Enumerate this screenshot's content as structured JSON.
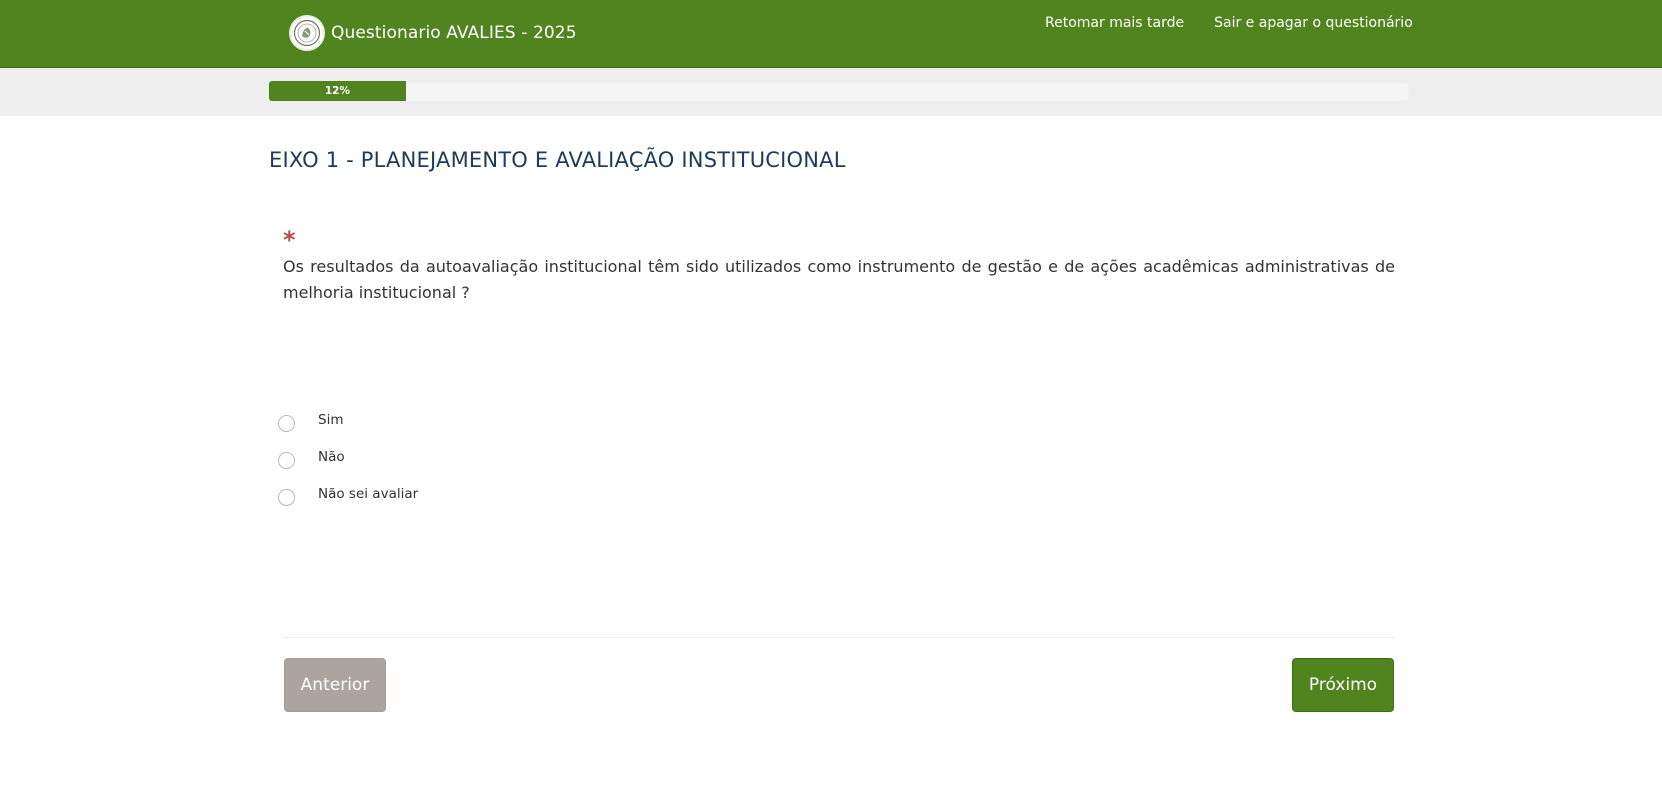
{
  "header": {
    "title": "Questionario AVALIES - 2025",
    "links": [
      {
        "label": "Retomar mais tarde"
      },
      {
        "label": "Sair e apagar o questionário"
      }
    ]
  },
  "progress": {
    "percent": 12,
    "label": "12%"
  },
  "section": {
    "title": "EIXO 1 - PLANEJAMENTO E AVALIAÇÃO INSTITUCIONAL"
  },
  "question": {
    "required_marker": "*",
    "text": "Os resultados da autoavaliação institucional têm sido utilizados como instrumento de gestão e de ações acadêmicas administrativas de melhoria institucional ?",
    "options": [
      {
        "label": "Sim"
      },
      {
        "label": "Não"
      },
      {
        "label": "Não sei avaliar"
      }
    ]
  },
  "navigation": {
    "prev_label": "Anterior",
    "next_label": "Próximo"
  },
  "colors": {
    "brand": "#4f841e",
    "required": "#b84a4a",
    "title": "#1f3a5a",
    "prev_button": "#aba49f"
  },
  "icons": {
    "logo": "institution-seal-icon",
    "required": "asterisk-icon",
    "option": "radio-button-icon"
  }
}
